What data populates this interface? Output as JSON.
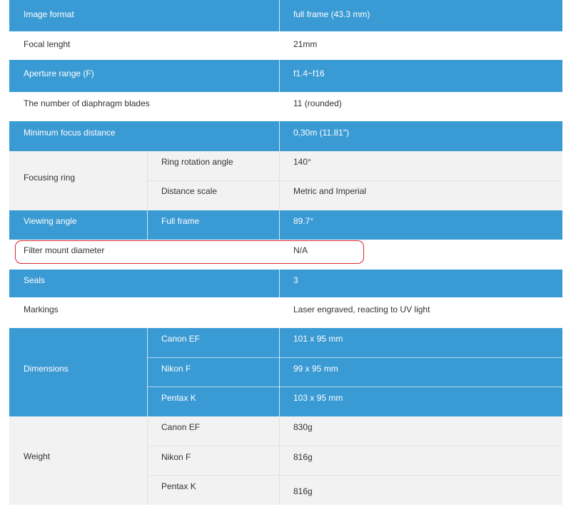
{
  "specs": {
    "image_format": {
      "label": "Image format",
      "value": "full frame (43.3 mm)"
    },
    "focal_length": {
      "label": "Focal lenght",
      "value": "21mm"
    },
    "aperture": {
      "label": "Aperture range (F)",
      "value": "f1.4~f16"
    },
    "blades": {
      "label": "The number of diaphragm blades",
      "value": "11 (rounded)"
    },
    "min_focus": {
      "label": "Minimum focus distance",
      "value": "0,30m (11.81″)"
    },
    "focusing_ring": {
      "label": "Focusing ring",
      "rows": [
        {
          "sub": "Ring rotation angle",
          "value": "140°"
        },
        {
          "sub": "Distance scale",
          "value": "Metric and Imperial"
        }
      ]
    },
    "viewing_angle": {
      "label": "Viewing angle",
      "sub": "Full frame",
      "value": "89.7°"
    },
    "filter": {
      "label": "Filter mount diameter",
      "value": "N/A"
    },
    "seals": {
      "label": "Seals",
      "value": "3"
    },
    "markings": {
      "label": "Markings",
      "value": "Laser engraved, reacting to UV light"
    },
    "dimensions": {
      "label": "Dimensions",
      "rows": [
        {
          "sub": "Canon EF",
          "value": "101 x 95 mm"
        },
        {
          "sub": "Nikon F",
          "value": "99 x 95 mm"
        },
        {
          "sub": "Pentax K",
          "value": "103 x 95 mm"
        }
      ]
    },
    "weight": {
      "label": "Weight",
      "rows": [
        {
          "sub": "Canon EF",
          "value": "830g"
        },
        {
          "sub": "Nikon F",
          "value": "816g"
        },
        {
          "sub": "Pentax K",
          "value": "816g"
        }
      ]
    }
  },
  "colors": {
    "header_blue": "#3a9ad4",
    "highlight_red": "#d9262f",
    "row_grey": "#f2f2f2"
  }
}
